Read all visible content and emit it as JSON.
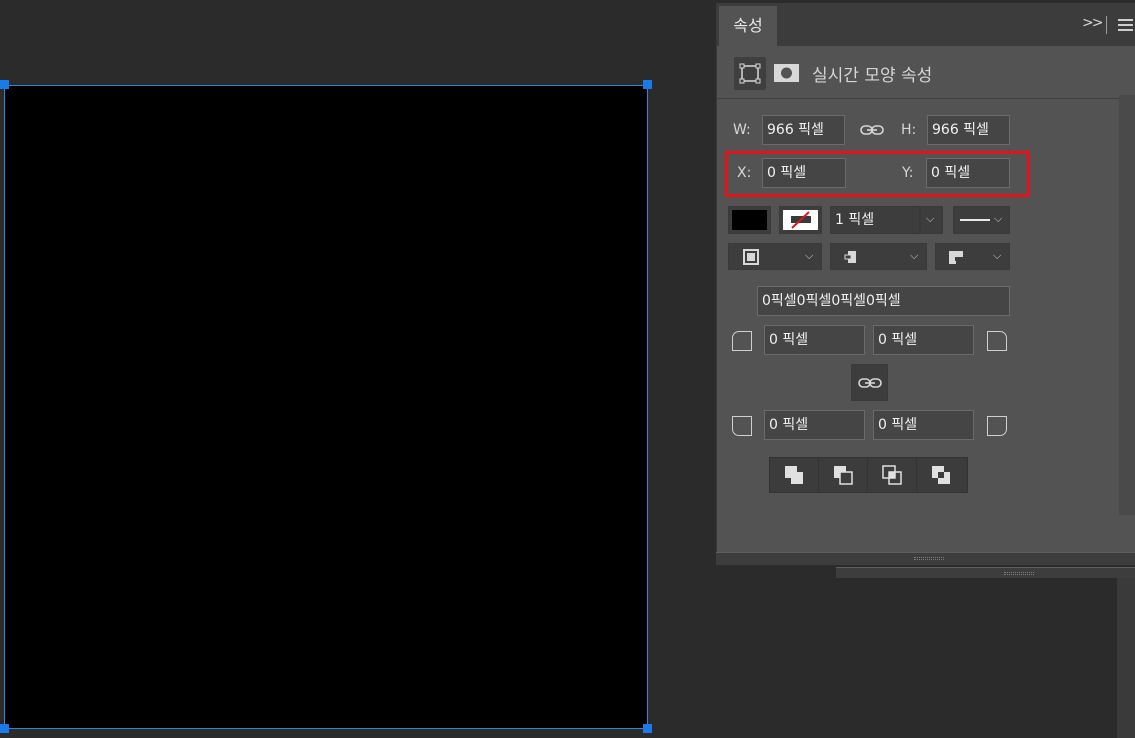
{
  "panel": {
    "tab_label": "속성",
    "collapse_label": ">>",
    "subheader_title": "실시간 모양 속성"
  },
  "transform": {
    "w_label": "W:",
    "w_value": "966 픽셀",
    "h_label": "H:",
    "h_value": "966 픽셀",
    "x_label": "X:",
    "x_value": "0 픽셀",
    "y_label": "Y:",
    "y_value": "0 픽셀"
  },
  "appearance": {
    "fill_color": "#000000",
    "stroke_width": "1 픽셀"
  },
  "corners": {
    "combined_value": "0픽셀0픽셀0픽셀0픽셀",
    "top_left": "0 픽셀",
    "top_right": "0 픽셀",
    "bottom_left": "0 픽셀",
    "bottom_right": "0 픽셀"
  },
  "colors": {
    "selection": "#1a7ae8",
    "highlight": "#e3131b",
    "panel_bg": "#535353"
  }
}
